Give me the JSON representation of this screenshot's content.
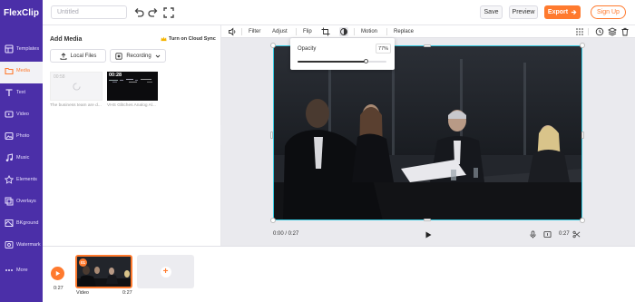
{
  "app": {
    "logo": "FlexClip",
    "project_name_placeholder": "Untitled"
  },
  "header": {
    "save": "Save",
    "preview": "Preview",
    "export": "Export",
    "signup": "Sign Up"
  },
  "sidebar": {
    "items": [
      {
        "label": "Templates",
        "icon": "templates-icon"
      },
      {
        "label": "Media",
        "icon": "folder-icon",
        "active": true
      },
      {
        "label": "Text",
        "icon": "text-icon"
      },
      {
        "label": "Video",
        "icon": "video-icon"
      },
      {
        "label": "Photo",
        "icon": "photo-icon"
      },
      {
        "label": "Music",
        "icon": "music-icon"
      },
      {
        "label": "Elements",
        "icon": "elements-icon"
      },
      {
        "label": "Overlays",
        "icon": "overlays-icon"
      },
      {
        "label": "BKground",
        "icon": "background-icon"
      },
      {
        "label": "Watermark",
        "icon": "watermark-icon"
      },
      {
        "label": "More",
        "icon": "more-icon"
      }
    ]
  },
  "media": {
    "title": "Add Media",
    "cloud_sync": "Turn on Cloud Sync",
    "local_files": "Local Files",
    "recording": "Recording",
    "items": [
      {
        "caption": "The business team are d...",
        "tag": "00:58"
      },
      {
        "caption": "VHS Glitches Analog Al...",
        "tag": "00:28"
      }
    ]
  },
  "toolbar": {
    "filter": "Filter",
    "adjust": "Adjust",
    "flip": "Flip",
    "motion": "Motion",
    "replace": "Replace"
  },
  "opacity": {
    "label": "Opacity",
    "value_text": "77%",
    "value": 0.77
  },
  "player": {
    "current": "0:00 / 0:27",
    "duration": "0:27"
  },
  "timeline": {
    "time": "0:27",
    "clip": {
      "index": "01",
      "label": "Video",
      "duration": "0:27"
    }
  },
  "colors": {
    "brand_purple": "#4b2fa8",
    "accent_orange": "#ff7a2e",
    "selection_cyan": "#36c9e0"
  }
}
